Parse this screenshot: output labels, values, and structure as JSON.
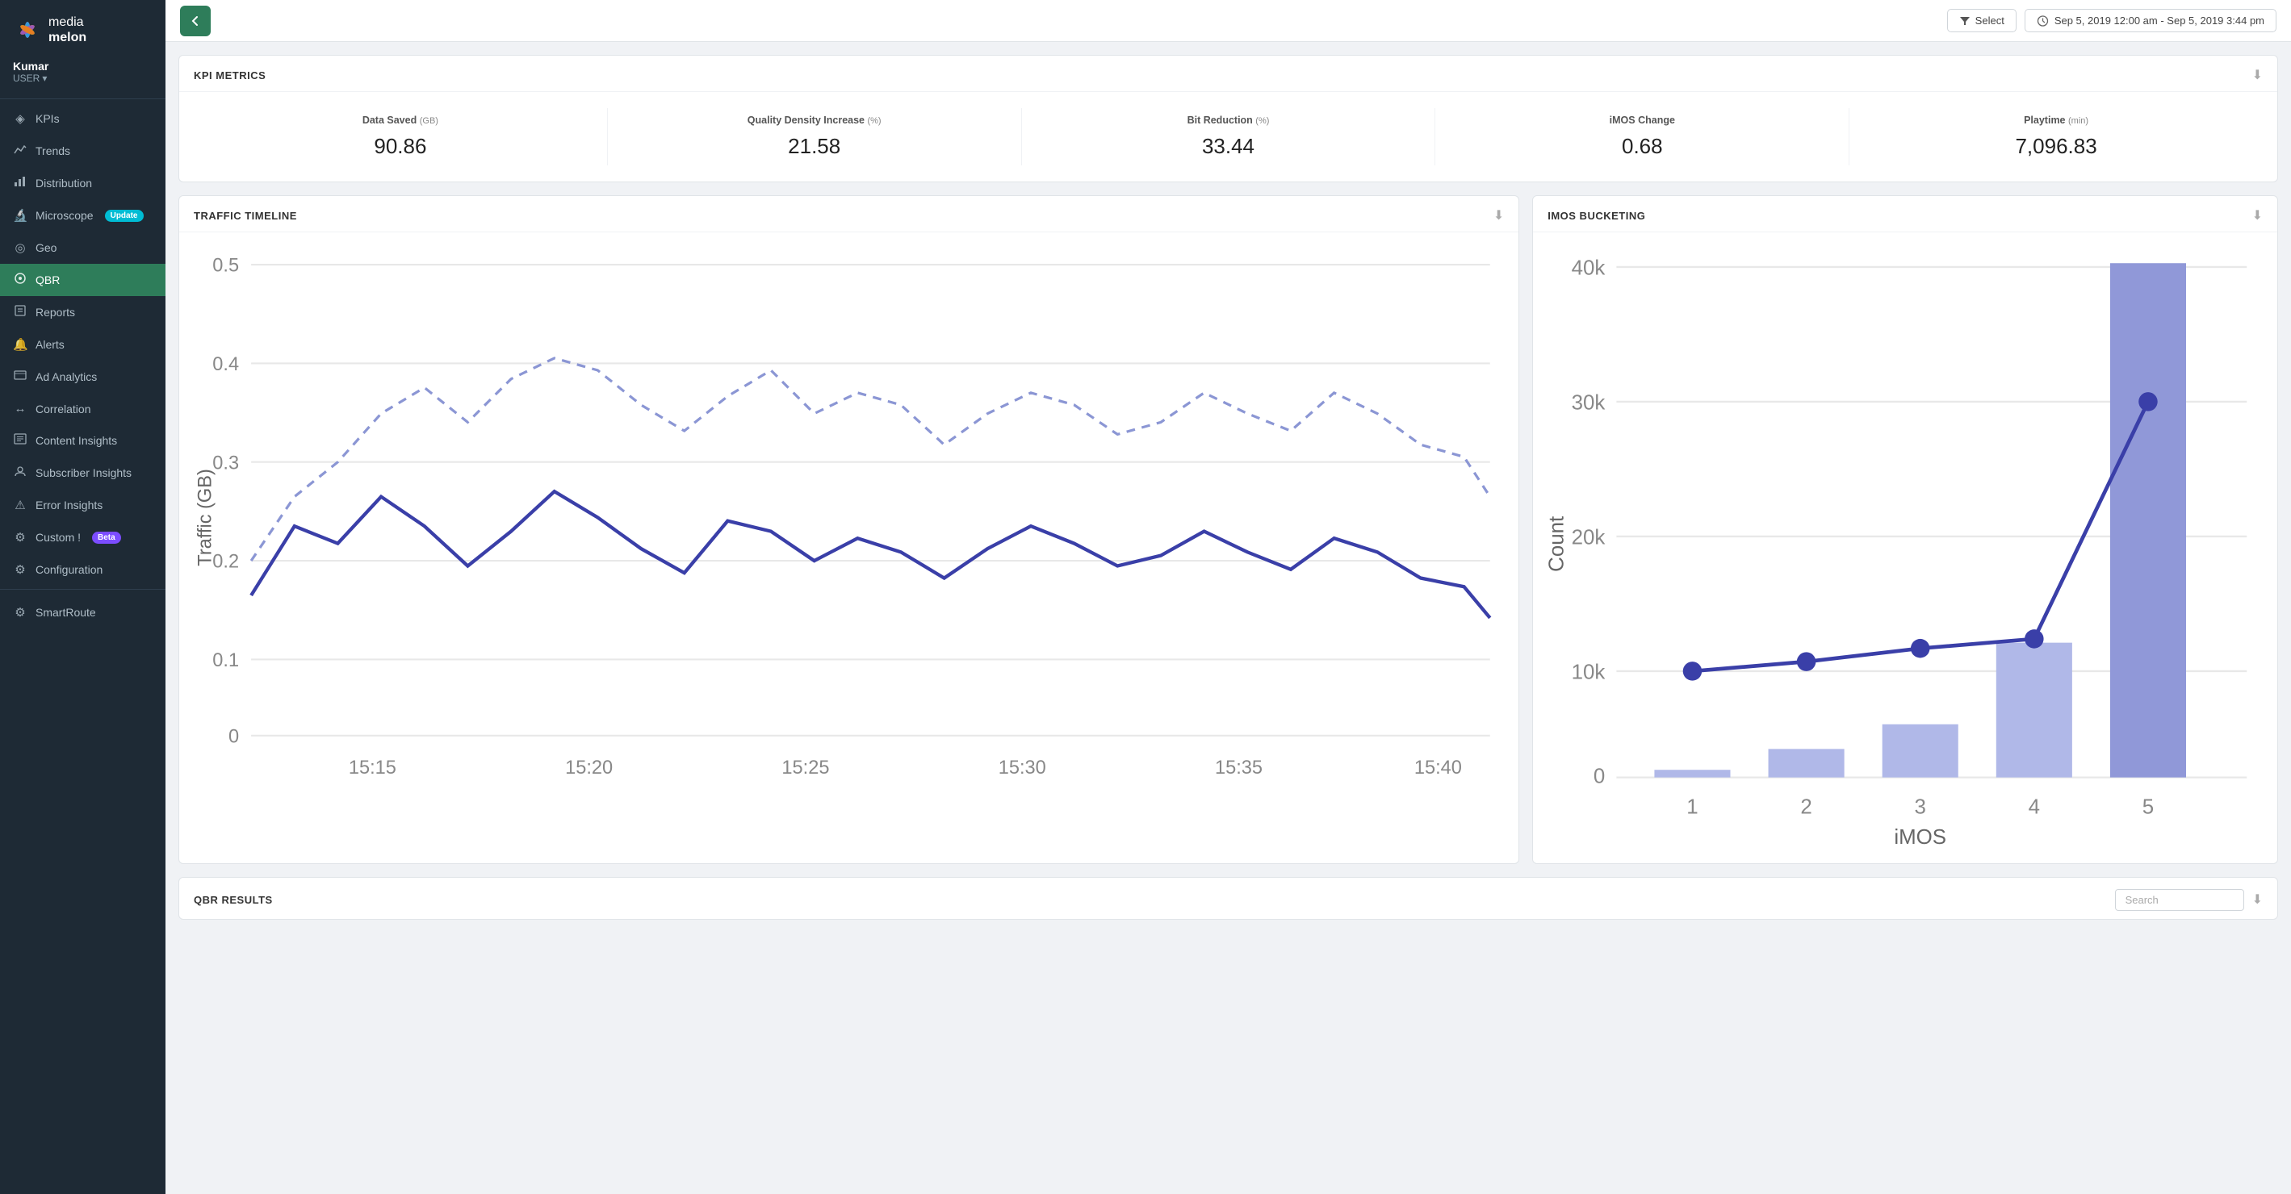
{
  "sidebar": {
    "logo": {
      "media": "media",
      "melon": "melon"
    },
    "user": {
      "name": "Kumar",
      "role": "USER"
    },
    "nav": [
      {
        "id": "kpis",
        "label": "KPIs",
        "icon": "◈",
        "active": false
      },
      {
        "id": "trends",
        "label": "Trends",
        "icon": "📈",
        "active": false
      },
      {
        "id": "distribution",
        "label": "Distribution",
        "icon": "📊",
        "active": false
      },
      {
        "id": "microscope",
        "label": "Microscope",
        "icon": "🔬",
        "badge": "Update",
        "badgeClass": "badge-update",
        "active": false
      },
      {
        "id": "geo",
        "label": "Geo",
        "icon": "📍",
        "active": false
      },
      {
        "id": "qbr",
        "label": "QBR",
        "icon": "⊙",
        "active": true
      },
      {
        "id": "reports",
        "label": "Reports",
        "icon": "🔔",
        "active": false
      },
      {
        "id": "alerts",
        "label": "Alerts",
        "icon": "🔔",
        "active": false
      },
      {
        "id": "ad-analytics",
        "label": "Ad Analytics",
        "icon": "📺",
        "active": false
      },
      {
        "id": "correlation",
        "label": "Correlation",
        "icon": "↔",
        "active": false
      },
      {
        "id": "content-insights",
        "label": "Content Insights",
        "icon": "📋",
        "active": false
      },
      {
        "id": "subscriber-insights",
        "label": "Subscriber Insights",
        "icon": "👤",
        "active": false
      },
      {
        "id": "error-insights",
        "label": "Error Insights",
        "icon": "⚠",
        "active": false
      },
      {
        "id": "custom",
        "label": "Custom !",
        "icon": "⚙",
        "badge": "Beta",
        "badgeClass": "badge-beta",
        "active": false
      },
      {
        "id": "configuration",
        "label": "Configuration",
        "icon": "⚙",
        "active": false
      }
    ],
    "bottom": {
      "label": "SmartRoute",
      "icon": "⚙"
    }
  },
  "topbar": {
    "select_label": "Select",
    "datetime": "Sep 5, 2019 12:00 am - Sep 5, 2019 3:44 pm"
  },
  "kpi": {
    "title": "KPI METRICS",
    "metrics": [
      {
        "label": "Data Saved",
        "unit": "(GB)",
        "value": "90.86"
      },
      {
        "label": "Quality Density Increase",
        "unit": "(%)",
        "value": "21.58"
      },
      {
        "label": "Bit Reduction",
        "unit": "(%)",
        "value": "33.44"
      },
      {
        "label": "iMOS Change",
        "unit": "",
        "value": "0.68"
      },
      {
        "label": "Playtime",
        "unit": "(min)",
        "value": "7,096.83"
      }
    ]
  },
  "traffic_timeline": {
    "title": "TRAFFIC TIMELINE",
    "y_label": "Traffic (GB)",
    "y_ticks": [
      "0.5",
      "0.4",
      "0.3",
      "0.2",
      "0.1",
      "0"
    ],
    "x_ticks": [
      "15:15",
      "15:20",
      "15:25",
      "15:30",
      "15:35",
      "15:40"
    ]
  },
  "imos_bucketing": {
    "title": "iMOS BUCKETING",
    "y_label": "Count",
    "y_ticks": [
      "40k",
      "30k",
      "20k",
      "10k",
      "0"
    ],
    "x_ticks": [
      "1",
      "2",
      "3",
      "4",
      "5"
    ],
    "x_label": "iMOS"
  },
  "qbr_results": {
    "title": "QBR RESULTS",
    "search_placeholder": "Search"
  }
}
